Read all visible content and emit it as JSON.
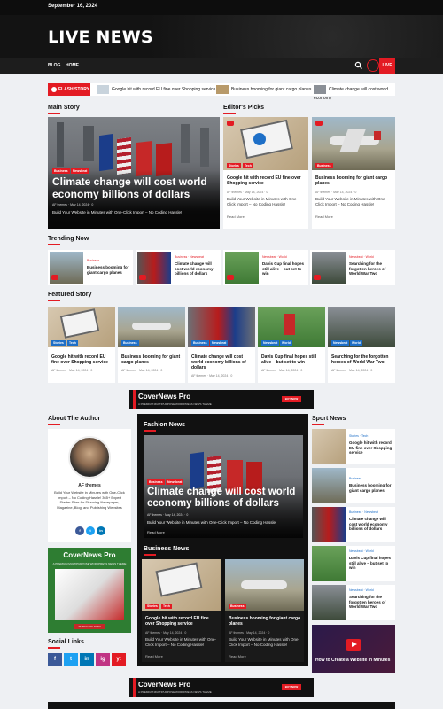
{
  "topbar": {
    "date": "September 16, 2024"
  },
  "header": {
    "logo": "LIVE NEWS"
  },
  "nav": {
    "items": [
      "BLOG",
      "HOME"
    ],
    "live_label": "LIVE"
  },
  "ticker": {
    "flash_label": "FLASH STORY",
    "items": [
      "Google hit with record EU fine over Shopping service",
      "Business booming for giant cargo planes",
      "Climate change will cost world economy"
    ]
  },
  "sections": {
    "main_story": "Main Story",
    "editors_picks": "Editor's Picks",
    "trending_now": "Trending Now",
    "featured_story": "Featured Story",
    "about_author": "About The Author",
    "fashion_news": "Fashion News",
    "sport_news": "Sport News",
    "business_news": "Business News",
    "social_links": "Social Links"
  },
  "main_story": {
    "badges": [
      "Business",
      "Newsbeat"
    ],
    "title": "Climate change will cost world economy billions of dollars",
    "author": "AF themes",
    "date": "May 14, 2024",
    "comments": "0",
    "desc": "Build Your Website in Minutes with One-Click Import – No Coding Hassle!"
  },
  "editors_picks": [
    {
      "badges": [
        "Stories",
        "Tech"
      ],
      "title": "Google hit with record EU fine over Shopping service",
      "author": "AF themes",
      "date": "May 14, 2024",
      "comments": "0",
      "desc": "Build Your Website in Minutes with One-Click Import – No Coding Hassle!",
      "more": "Read More"
    },
    {
      "badges": [
        "Business"
      ],
      "title": "Business booming for giant cargo planes",
      "author": "AF themes",
      "date": "May 14, 2024",
      "comments": "0",
      "desc": "Build Your Website in Minutes with One-Click Import – No Coding Hassle!",
      "more": "Read More"
    }
  ],
  "trending": [
    {
      "cats": "Business",
      "title": "Business booming for giant cargo planes"
    },
    {
      "cats": "Business · Newsbeat",
      "title": "Climate change will cost world economy billions of dollars"
    },
    {
      "cats": "Newsbeat · World",
      "title": "Davis Cup final hopes still alive – but set to win"
    },
    {
      "cats": "Newsbeat · World",
      "title": "Searching for the forgotten heroes of World War Two"
    }
  ],
  "featured": [
    {
      "badges": [
        "Stories",
        "Tech"
      ],
      "title": "Google hit with record EU fine over Shopping service",
      "author": "AF themes",
      "date": "May 14, 2024",
      "comments": "0"
    },
    {
      "badges": [
        "Business"
      ],
      "title": "Business booming for giant cargo planes",
      "author": "AF themes",
      "date": "May 14, 2024",
      "comments": "0"
    },
    {
      "badges": [
        "Business",
        "Newsbeat"
      ],
      "title": "Climate change will cost world economy billions of dollars",
      "author": "AF themes",
      "date": "May 14, 2024",
      "comments": "0"
    },
    {
      "badges": [
        "Newsbeat",
        "World"
      ],
      "title": "Davis Cup final hopes still alive – but set to win",
      "author": "AF themes",
      "date": "May 14, 2024",
      "comments": "0"
    },
    {
      "badges": [
        "Newsbeat",
        "World"
      ],
      "title": "Searching for the forgotten heroes of World War Two",
      "author": "AF themes",
      "date": "May 14, 2024",
      "comments": "0"
    }
  ],
  "ad": {
    "title": "CoverNews Pro",
    "sub": "A PREMIUM MULTIPURPOSE WORDPRESS NEWS THEME",
    "btn": "BUY NOW"
  },
  "author": {
    "name": "AF themes",
    "bio": "Build Your Website in Minutes with One-Click Import – No Coding Hassle! 365+ Expert Starter Sites for Stunning Newspaper, Magazine, Blog, and Publishing Websites"
  },
  "side_ad": {
    "title": "CoverNews Pro",
    "sub": "A PREMIUM MULTIPURPOSE WORDPRESS NEWS THEME",
    "btn": "PURCHASE NOW"
  },
  "fashion": {
    "badges": [
      "Business",
      "Newsbeat"
    ],
    "title": "Climate change will cost world economy billions of dollars",
    "author": "AF themes",
    "date": "May 14, 2024",
    "comments": "0",
    "desc": "Build Your Website in Minutes with One-Click Import – No Coding Hassle!",
    "more": "Read More"
  },
  "business": [
    {
      "badges": [
        "Stories",
        "Tech"
      ],
      "title": "Google hit with record EU fine over Shopping service",
      "author": "AF themes",
      "date": "May 14, 2024",
      "comments": "0",
      "desc": "Build Your Website in Minutes with One-Click Import – No Coding Hassle!",
      "more": "Read More"
    },
    {
      "badges": [
        "Business"
      ],
      "title": "Business booming for giant cargo planes",
      "author": "AF themes",
      "date": "May 14, 2024",
      "comments": "0",
      "desc": "Build Your Website in Minutes with One-Click Import – No Coding Hassle!",
      "more": "Read More"
    }
  ],
  "sport": [
    {
      "cats": "Stories · Tech",
      "title": "Google hit with record EU fine over Shopping service"
    },
    {
      "cats": "Business",
      "title": "Business booming for giant cargo planes"
    },
    {
      "cats": "Business · Newsbeat",
      "title": "Climate change will cost world economy billions of dollars"
    },
    {
      "cats": "Newsbeat · World",
      "title": "Davis Cup final hopes still alive – but set to win"
    },
    {
      "cats": "Newsbeat · World",
      "title": "Searching for the forgotten heroes of World War Two"
    }
  ],
  "video": {
    "title": "How to Create a Website in Minutes"
  },
  "social": [
    "f",
    "t",
    "in",
    "ig",
    "yt"
  ]
}
